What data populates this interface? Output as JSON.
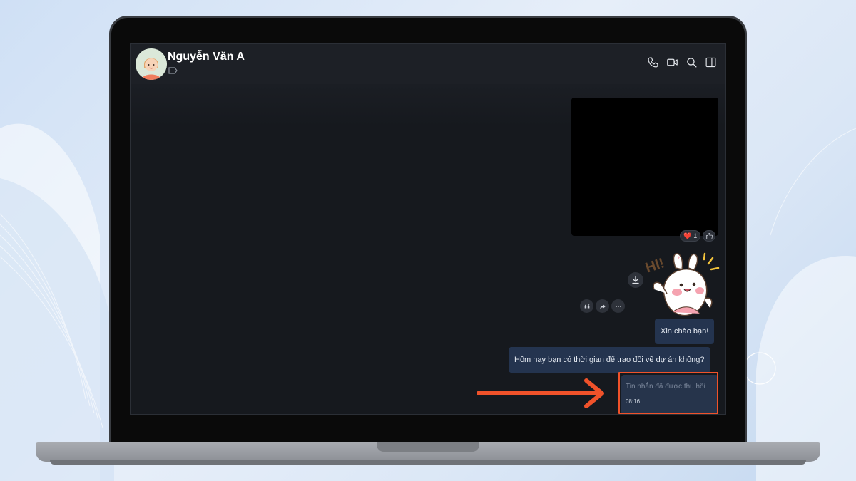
{
  "chat": {
    "contact_name": "Nguyễn Văn A",
    "header_actions": [
      "phone-icon",
      "video-call-icon",
      "search-icon",
      "sidebar-toggle-icon"
    ]
  },
  "messages": {
    "reaction": {
      "emoji": "❤️",
      "count": "1"
    },
    "bubble_1": "Xin chào bạn!",
    "bubble_2": "Hôm nay bạn có thời gian để trao đổi về dự án không?",
    "recalled": {
      "text": "Tin nhắn đã được thu hồi",
      "time": "08:16"
    }
  },
  "sticker": {
    "text": "HI!"
  },
  "colors": {
    "accent_highlight": "#f0522a",
    "bubble": "#24344f",
    "screen_bg": "#16191e"
  }
}
